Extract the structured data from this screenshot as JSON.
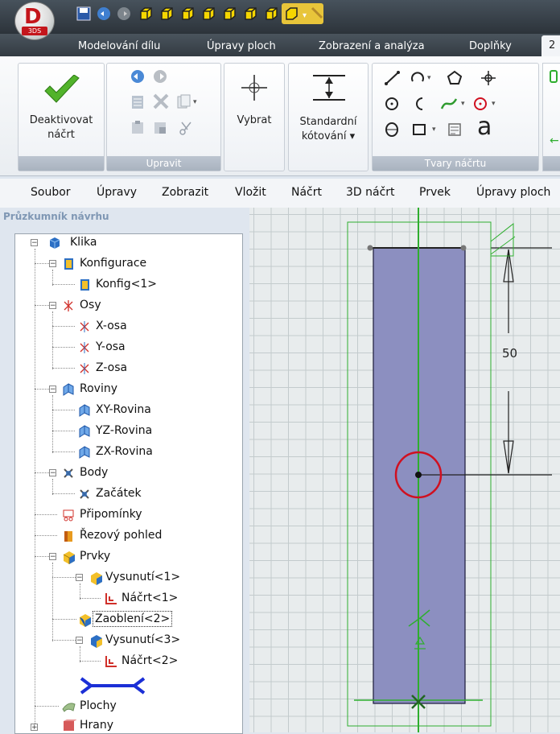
{
  "app": {
    "logo_letter": "D",
    "logo_sub": "3DS"
  },
  "ribbon_tabs": [
    "Modelování dílu",
    "Úpravy ploch",
    "Zobrazení a analýza",
    "Doplňky",
    "2"
  ],
  "ribbon": {
    "deactivate": "Deaktivovat\nnáčrt",
    "deactivate_l1": "Deaktivovat",
    "deactivate_l2": "náčrt",
    "edit_group": "Upravit",
    "select": "Vybrat",
    "dim_l1": "Standardní",
    "dim_l2": "kótování ▾",
    "shapes_group": "Tvary náčrtu",
    "text_glyph": "a"
  },
  "menubar": [
    "Soubor",
    "Úpravy",
    "Zobrazit",
    "Vložit",
    "Náčrt",
    "3D náčrt",
    "Prvek",
    "Úpravy ploch"
  ],
  "explorer": {
    "title": "Průzkumník návrhu",
    "nodes": [
      {
        "label": "Klika",
        "icon": "part-icon"
      },
      {
        "label": "Konfigurace",
        "icon": "config-icon"
      },
      {
        "label": "Konfig<1>",
        "icon": "config-icon"
      },
      {
        "label": "Osy",
        "icon": "axes-icon"
      },
      {
        "label": "X-osa",
        "icon": "axis-icon"
      },
      {
        "label": "Y-osa",
        "icon": "axis-icon"
      },
      {
        "label": "Z-osa",
        "icon": "axis-icon"
      },
      {
        "label": "Roviny",
        "icon": "plane-icon"
      },
      {
        "label": "XY-Rovina",
        "icon": "plane-icon"
      },
      {
        "label": "YZ-Rovina",
        "icon": "plane-icon"
      },
      {
        "label": "ZX-Rovina",
        "icon": "plane-icon"
      },
      {
        "label": "Body",
        "icon": "point-icon"
      },
      {
        "label": "Začátek",
        "icon": "point-icon"
      },
      {
        "label": "Připomínky",
        "icon": "notes-icon"
      },
      {
        "label": "Řezový pohled",
        "icon": "section-icon"
      },
      {
        "label": "Prvky",
        "icon": "features-icon"
      },
      {
        "label": "Vysunutí<1>",
        "icon": "extrude-icon"
      },
      {
        "label": "Náčrt<1>",
        "icon": "sketch-icon"
      },
      {
        "label": "Zaoblení<2>",
        "icon": "fillet-icon"
      },
      {
        "label": "Vysunutí<3>",
        "icon": "extrude-icon"
      },
      {
        "label": "Náčrt<2>",
        "icon": "sketch-icon"
      },
      {
        "label": "Plochy",
        "icon": "surfaces-icon"
      },
      {
        "label": "Hrany",
        "icon": "edges-icon"
      }
    ]
  },
  "viewport": {
    "dimension_value": "50"
  },
  "colors": {
    "accent": "#1a6fb5",
    "sketch_green": "#2eae2e",
    "circle_red": "#d01020",
    "fill": "#8c8fc0"
  }
}
